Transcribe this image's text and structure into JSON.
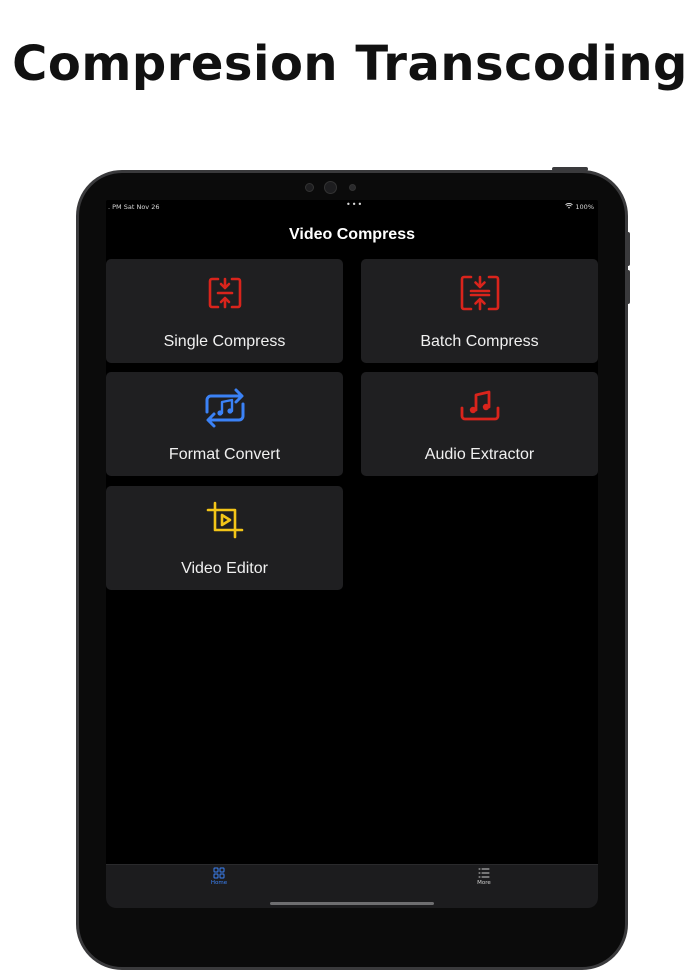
{
  "headline": "Compresion Transcoding",
  "status_bar": {
    "time_date": ". PM   Sat Nov 26",
    "dots": "•••",
    "battery": "100%"
  },
  "app": {
    "title": "Video Compress",
    "cards": [
      {
        "label": "Single Compress",
        "icon": "compress-icon",
        "color": "#d9241c"
      },
      {
        "label": "Batch Compress",
        "icon": "batch-compress-icon",
        "color": "#d9241c"
      },
      {
        "label": "Format Convert",
        "icon": "music-convert-icon",
        "color": "#3b82f6"
      },
      {
        "label": "Audio Extractor",
        "icon": "music-note-icon",
        "color": "#d9241c"
      },
      {
        "label": "Video Editor",
        "icon": "crop-video-icon",
        "color": "#f3c518"
      }
    ]
  },
  "tabbar": {
    "items": [
      {
        "label": "Home",
        "icon": "grid-icon",
        "color": "#3b82f6"
      },
      {
        "label": "More",
        "icon": "list-icon",
        "color": "#d0d0d0"
      }
    ]
  }
}
